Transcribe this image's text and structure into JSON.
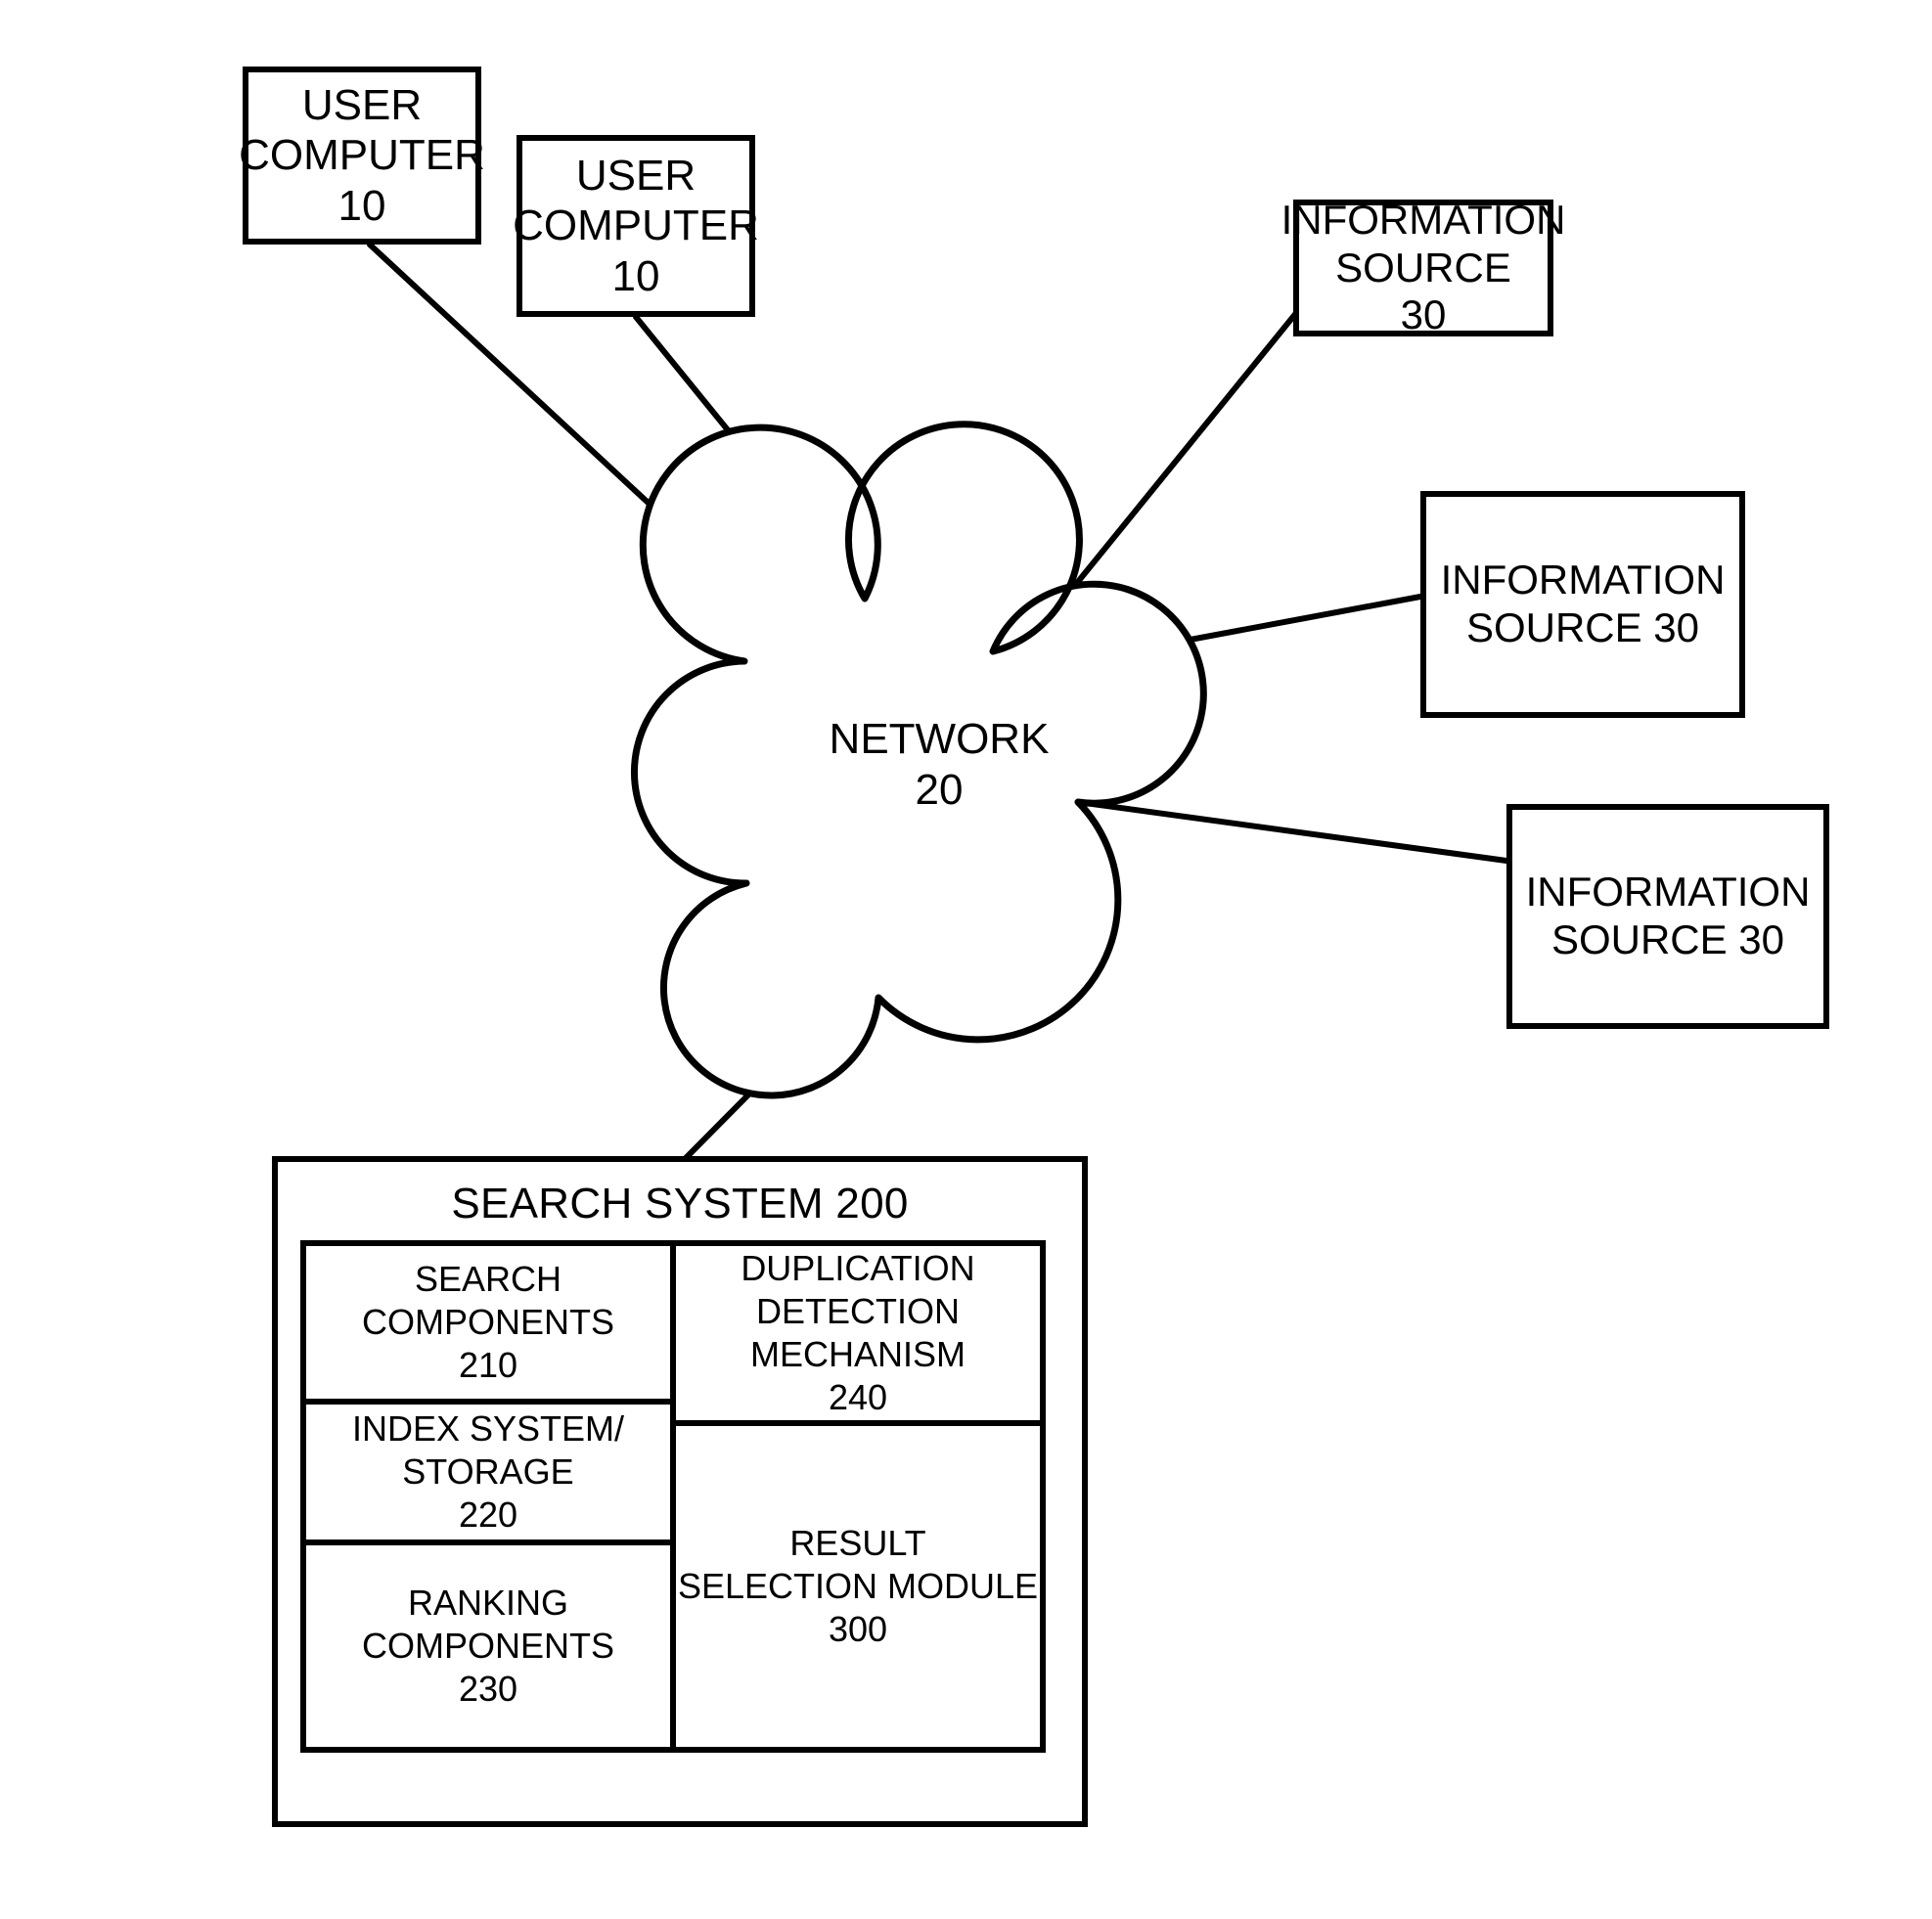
{
  "figure": {
    "title": "Search system network architecture diagram",
    "stroke_color": "#000000",
    "background_color": "#ffffff"
  },
  "nodes": {
    "user_computer_1": {
      "lines": [
        "USER",
        "COMPUTER",
        "10"
      ],
      "label": "USER COMPUTER",
      "reference_numeral": "10"
    },
    "user_computer_2": {
      "lines": [
        "USER",
        "COMPUTER",
        "10"
      ],
      "label": "USER COMPUTER",
      "reference_numeral": "10"
    },
    "information_source_1": {
      "lines": [
        "INFORMATION",
        "SOURCE",
        "30"
      ],
      "label": "INFORMATION SOURCE",
      "reference_numeral": "30"
    },
    "information_source_2": {
      "lines": [
        "INFORMATION",
        "SOURCE 30"
      ],
      "label": "INFORMATION SOURCE",
      "reference_numeral": "30"
    },
    "information_source_3": {
      "lines": [
        "INFORMATION",
        "SOURCE 30"
      ],
      "label": "INFORMATION SOURCE",
      "reference_numeral": "30"
    },
    "network": {
      "lines": [
        "NETWORK",
        "20"
      ],
      "label": "NETWORK",
      "reference_numeral": "20",
      "shape": "cloud"
    }
  },
  "search_system": {
    "title": "SEARCH SYSTEM 200",
    "label": "SEARCH SYSTEM",
    "reference_numeral": "200",
    "components": {
      "search_components": {
        "lines": [
          "SEARCH",
          "COMPONENTS",
          "210"
        ],
        "label": "SEARCH COMPONENTS",
        "reference_numeral": "210"
      },
      "index_system": {
        "lines": [
          "INDEX SYSTEM/",
          "STORAGE",
          "220"
        ],
        "label": "INDEX SYSTEM/STORAGE",
        "reference_numeral": "220"
      },
      "ranking_components": {
        "lines": [
          "RANKING",
          "COMPONENTS",
          "230"
        ],
        "label": "RANKING COMPONENTS",
        "reference_numeral": "230"
      },
      "duplication_detection": {
        "lines": [
          "DUPLICATION",
          "DETECTION",
          "MECHANISM",
          "240"
        ],
        "label": "DUPLICATION DETECTION MECHANISM",
        "reference_numeral": "240"
      },
      "result_selection": {
        "lines": [
          "RESULT",
          "SELECTION MODULE",
          "300"
        ],
        "label": "RESULT SELECTION MODULE",
        "reference_numeral": "300"
      }
    }
  },
  "connections": [
    {
      "from": "user_computer_1",
      "to": "network"
    },
    {
      "from": "user_computer_2",
      "to": "network"
    },
    {
      "from": "information_source_1",
      "to": "network"
    },
    {
      "from": "information_source_2",
      "to": "network"
    },
    {
      "from": "information_source_3",
      "to": "network"
    },
    {
      "from": "search_system",
      "to": "network"
    }
  ]
}
